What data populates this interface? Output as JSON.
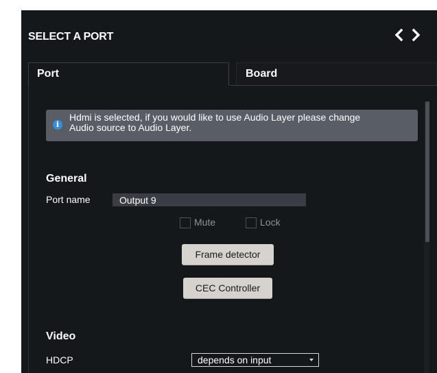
{
  "header": {
    "title": "SELECT A PORT",
    "prev_icon": "chevron-left-icon",
    "next_icon": "chevron-right-icon"
  },
  "tabs": [
    {
      "label": "Port",
      "active": true
    },
    {
      "label": "Board",
      "active": false
    }
  ],
  "info": {
    "icon": "info-icon",
    "icon_glyph": "i",
    "line1": "Hdmi is selected, if you would like to use Audio Layer please change",
    "line2": "Audio source to Audio Layer."
  },
  "general": {
    "heading": "General",
    "port_name_label": "Port name",
    "port_name_value": "Output 9",
    "mute_label": "Mute",
    "mute_checked": false,
    "lock_label": "Lock",
    "lock_checked": false,
    "frame_detector_label": "Frame detector",
    "cec_controller_label": "CEC Controller"
  },
  "video": {
    "heading": "Video",
    "hdcp_label": "HDCP",
    "hdcp_value": "depends on input"
  },
  "colors": {
    "panel_bg": "#15181b",
    "info_bg": "#595e66",
    "info_icon": "#3a8fd6",
    "button_bg": "#d6d3cf",
    "input_bg": "#3a3e44"
  }
}
